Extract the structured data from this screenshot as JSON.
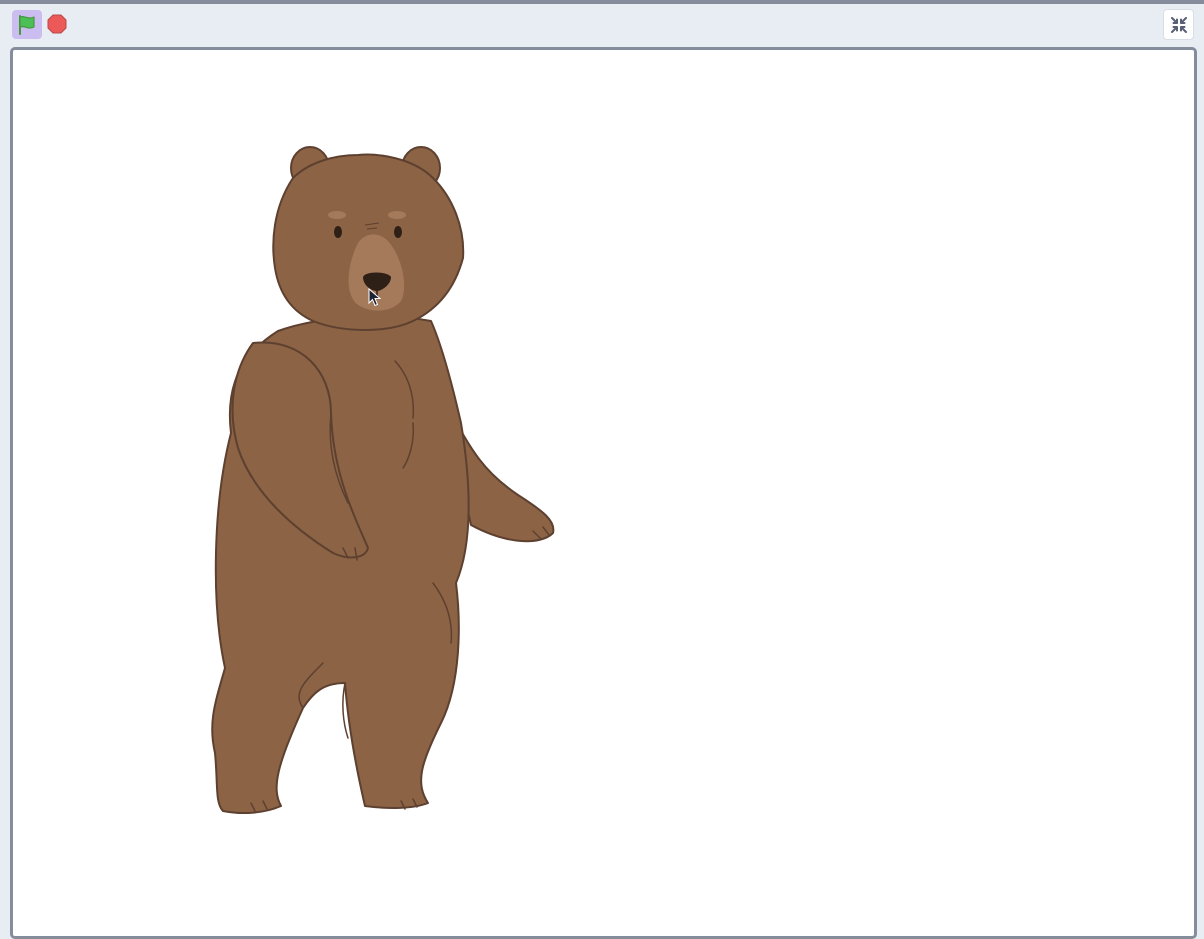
{
  "controls": {
    "green_flag": {
      "icon": "green-flag-icon",
      "active": true,
      "color": "#4cae4c",
      "highlight": "#cbbdf0"
    },
    "stop": {
      "icon": "stop-sign-icon",
      "color": "#ec5959"
    },
    "fullscreen": {
      "icon": "exit-fullscreen-icon",
      "color": "#575e75"
    }
  },
  "stage": {
    "background": "#ffffff",
    "border_color": "#858d9c",
    "sprite": {
      "name": "Bear",
      "fur_color": "#8c6344",
      "muzzle_color": "#a47a5b",
      "outline_color": "#5d4030"
    },
    "cursor": "arrow-cursor-icon"
  }
}
